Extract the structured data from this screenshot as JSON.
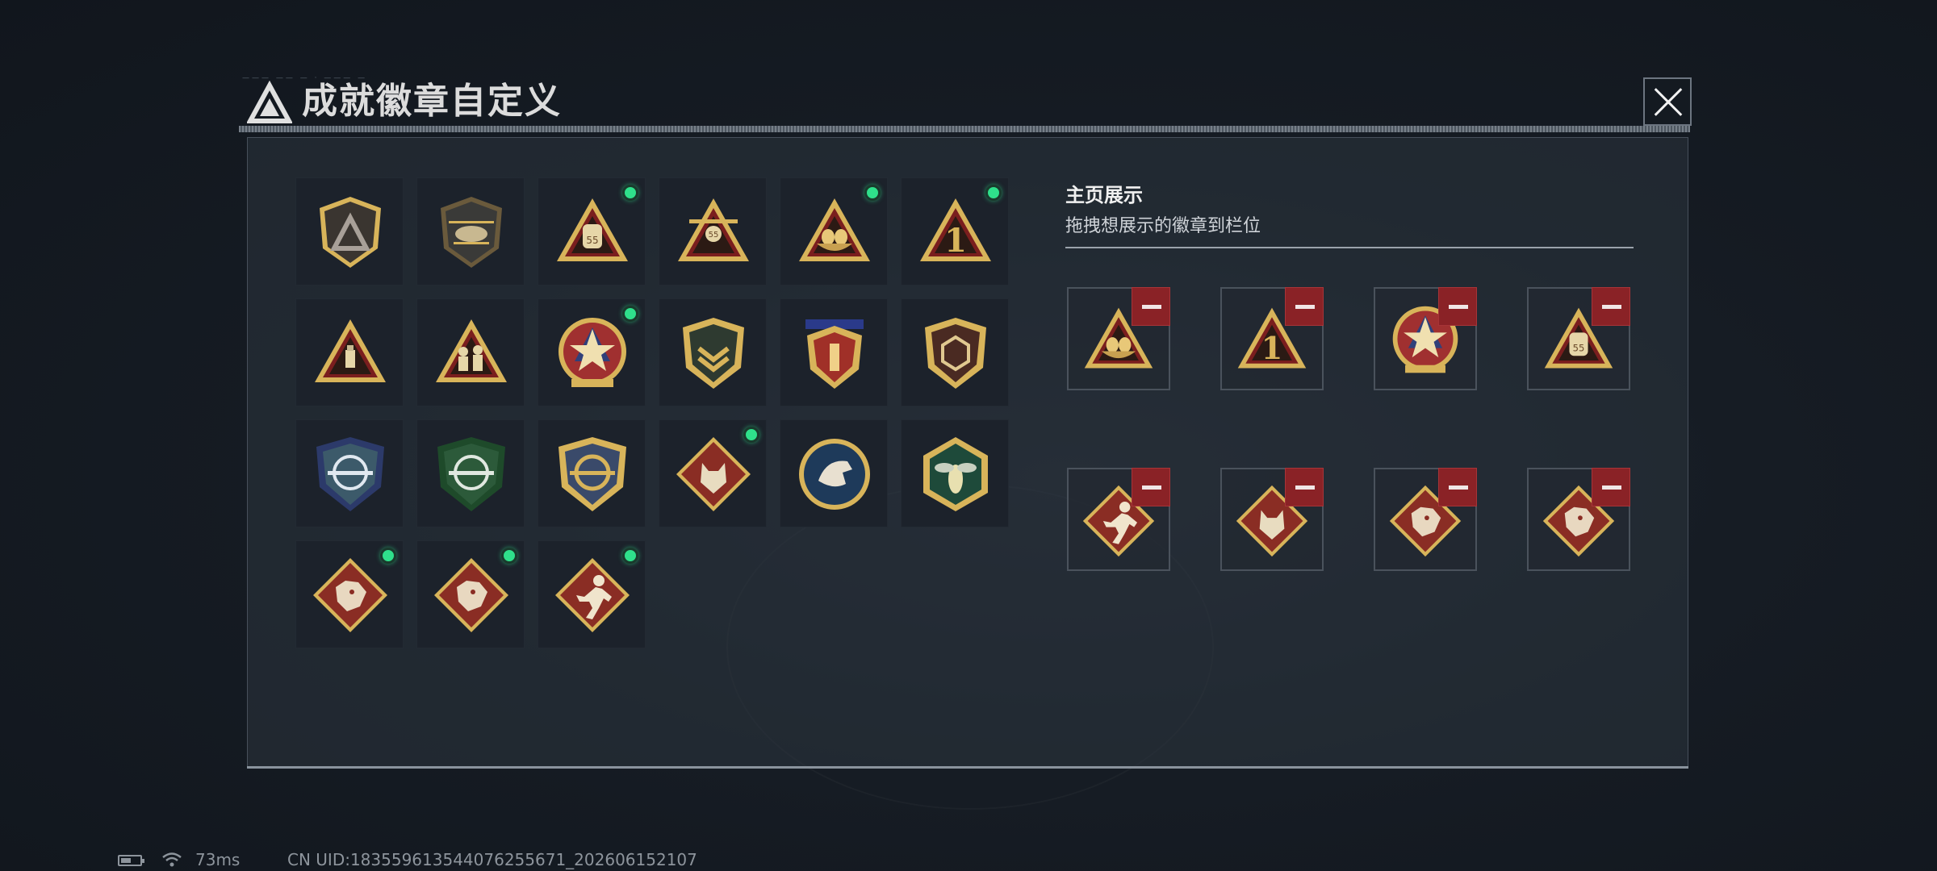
{
  "header": {
    "title": "成就徽章自定义",
    "deco_text": "——— —— — · ——— —"
  },
  "badges": [
    {
      "icon": "shield-logo-badge",
      "new": false
    },
    {
      "icon": "helicopter-badge",
      "new": false
    },
    {
      "icon": "backpack-55-badge",
      "new": true
    },
    {
      "icon": "plane-55-badge",
      "new": false
    },
    {
      "icon": "eggs-nest-badge",
      "new": true
    },
    {
      "icon": "number-one-badge",
      "new": true
    },
    {
      "icon": "usb-triangle-badge",
      "new": false
    },
    {
      "icon": "soldiers-triangle-badge",
      "new": false
    },
    {
      "icon": "star-medal-badge",
      "new": true
    },
    {
      "icon": "chevron-shield-badge",
      "new": false
    },
    {
      "icon": "winged-shield-badge",
      "new": false
    },
    {
      "icon": "dice-shield-badge",
      "new": false
    },
    {
      "icon": "blue-crosshair-rifle-badge",
      "new": false
    },
    {
      "icon": "green-crosshair-rifle-badge",
      "new": false
    },
    {
      "icon": "gold-crosshair-sword-badge",
      "new": false
    },
    {
      "icon": "wolf-diamond-badge",
      "new": true
    },
    {
      "icon": "eagle-circle-badge",
      "new": false
    },
    {
      "icon": "hornet-hexagon-badge",
      "new": false
    },
    {
      "icon": "dragon-diamond-badge",
      "new": true
    },
    {
      "icon": "dragon-diamond-badge",
      "new": true
    },
    {
      "icon": "runner-diamond-badge",
      "new": true
    }
  ],
  "showcase": {
    "title": "主页展示",
    "subtitle": "拖拽想展示的徽章到栏位",
    "slots": [
      {
        "icon": "eggs-nest-badge"
      },
      {
        "icon": "number-one-badge"
      },
      {
        "icon": "star-medal-badge"
      },
      {
        "icon": "backpack-55-badge"
      },
      {
        "icon": "runner-diamond-badge"
      },
      {
        "icon": "wolf-diamond-badge"
      },
      {
        "icon": "dragon-diamond-badge"
      },
      {
        "icon": "dragon-diamond-badge"
      }
    ]
  },
  "footer": {
    "ping": "73ms",
    "uid": "CN UID:18355961354407625567​1_202606152107"
  },
  "colors": {
    "new_dot": "#2fe08b",
    "remove_button": "#8a2226",
    "gold": "#d8b45a",
    "crimson": "#7a1e1e"
  }
}
